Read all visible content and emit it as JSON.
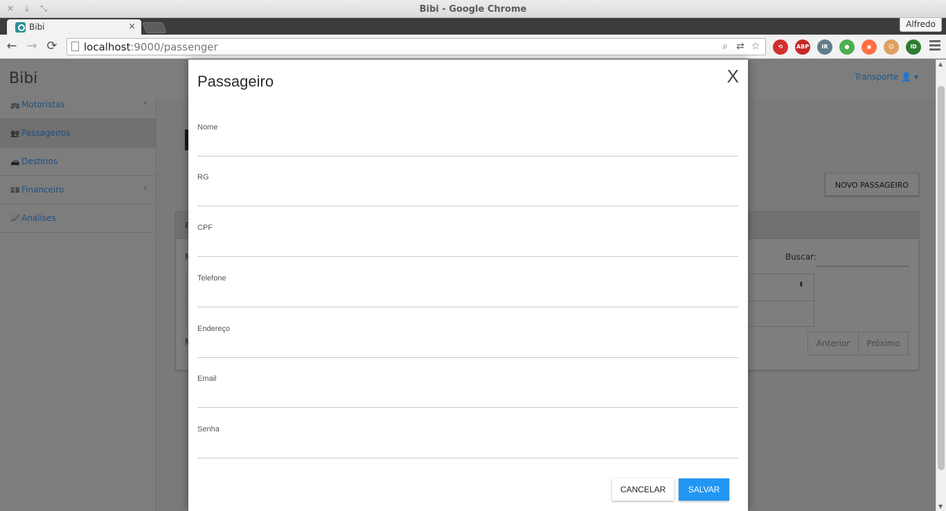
{
  "window": {
    "title": "Bibi - Google Chrome",
    "controls": [
      "×",
      "⤓",
      "⤡"
    ]
  },
  "tabs": {
    "active_label": "Bibi",
    "close": "×",
    "profile": "Alfredo"
  },
  "toolbar": {
    "back": "←",
    "forward": "→",
    "reload": "⟳",
    "url_host": "localhost",
    "url_rest": ":9000/passenger",
    "omni_icons": [
      "zoom-icon",
      "translate-icon",
      "star-icon"
    ],
    "omni_glyphs": [
      "⌕",
      "⇄",
      "☆"
    ],
    "extensions": [
      {
        "name": "redirect-extension-icon",
        "glyph": "⟲",
        "color": "#d32f2f"
      },
      {
        "name": "adblock-plus-icon",
        "glyph": "ABP",
        "color": "#c62828"
      },
      {
        "name": "ir-extension-icon",
        "glyph": "IR",
        "color": "#607d8b"
      },
      {
        "name": "evernote-icon",
        "glyph": "●",
        "color": "#4caf50"
      },
      {
        "name": "colorpick-icon",
        "glyph": "◉",
        "color": "#ff7043"
      },
      {
        "name": "character-extension-icon",
        "glyph": "☺",
        "color": "#e0a060"
      },
      {
        "name": "id-extension-icon",
        "glyph": "ID",
        "color": "#2e7d32"
      }
    ]
  },
  "app": {
    "brand": "Bibi",
    "user_menu": "Transporte 👤 ▾",
    "sidebar": [
      {
        "label": "Motoristas",
        "icon": "🚌",
        "chevron": "‹",
        "active": false
      },
      {
        "label": "Passageiros",
        "icon": "👥",
        "chevron": "",
        "active": true
      },
      {
        "label": "Destinos",
        "icon": "🚗",
        "chevron": "",
        "active": false
      },
      {
        "label": "Financeiro",
        "icon": "💵",
        "chevron": "‹",
        "active": false
      },
      {
        "label": "Análises",
        "icon": "📈",
        "chevron": "",
        "active": false
      }
    ],
    "new_button": "NOVO PASSAGEIRO",
    "search_label": "Buscar:",
    "pager": {
      "prev": "Anterior",
      "next": "Próximo"
    },
    "sort_glyph": "⬍",
    "ghost_letters": {
      "panel": "P",
      "m1": "M",
      "m2": "M"
    }
  },
  "modal": {
    "title": "Passageiro",
    "close": "X",
    "fields": [
      {
        "label": "Nome",
        "value": ""
      },
      {
        "label": "RG",
        "value": ""
      },
      {
        "label": "CPF",
        "value": ""
      },
      {
        "label": "Telefone",
        "value": ""
      },
      {
        "label": "Endereço",
        "value": ""
      },
      {
        "label": "Email",
        "value": ""
      },
      {
        "label": "Senha",
        "value": ""
      }
    ],
    "cancel": "CANCELAR",
    "save": "SALVAR",
    "save_color": "#2196f3"
  }
}
